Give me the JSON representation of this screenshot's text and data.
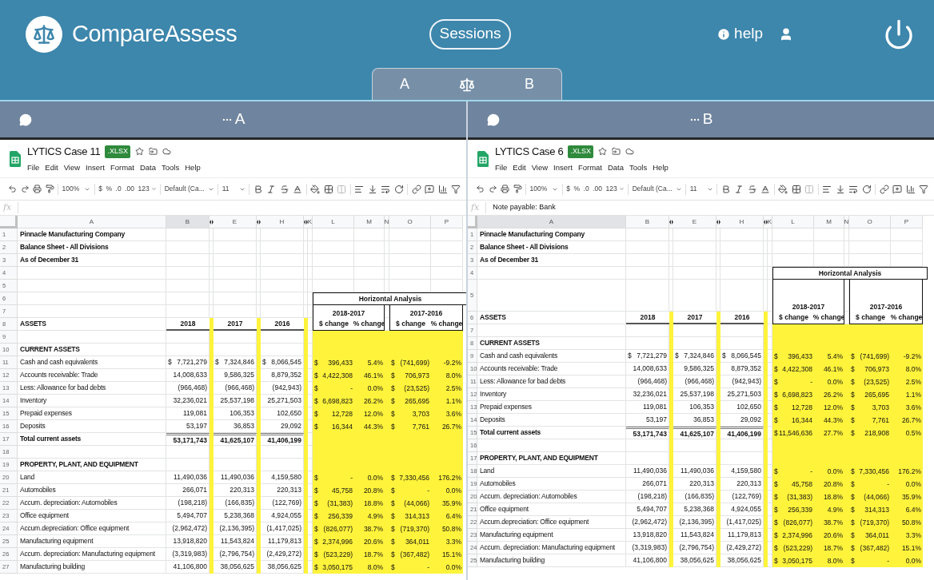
{
  "app": {
    "name": "CompareAssess",
    "sessions": "Sessions",
    "help": "help"
  },
  "compare_tabs": [
    "A",
    "B"
  ],
  "panes": [
    {
      "label": "A",
      "doc": {
        "title": "LYTICS Case 11",
        "badge": ".XLSX",
        "menu": [
          "File",
          "Edit",
          "View",
          "Insert",
          "Format",
          "Data",
          "Tools",
          "Help"
        ]
      },
      "toolbar": {
        "zoom": "100%",
        "currency": "$",
        "percent": "%",
        "dec_less": ".0",
        "dec_more": ".00",
        "format": "123",
        "font": "Default (Ca...",
        "size": "11"
      },
      "formula": {
        "label": "fx"
      },
      "columns": [
        {
          "label": "A",
          "selected": false
        },
        {
          "label": "B",
          "selected": true
        },
        {
          "label": "E",
          "selected": false
        },
        {
          "label": "H",
          "selected": false
        },
        {
          "label": "K",
          "selected": false
        },
        {
          "label": "L",
          "selected": false
        },
        {
          "label": "M",
          "selected": false
        },
        {
          "label": "N",
          "selected": false
        },
        {
          "label": "O",
          "selected": false
        },
        {
          "label": "P",
          "selected": false
        }
      ],
      "rows": [
        {
          "n": "1",
          "kind": "title",
          "a": "Pinnacle Manufacturing Company",
          "highlight": false,
          "tall": false
        },
        {
          "n": "2",
          "kind": "title",
          "a": "Balance Sheet - All Divisions",
          "highlight": false,
          "tall": false
        },
        {
          "n": "3",
          "kind": "title",
          "a": "As of December 31",
          "highlight": false,
          "tall": false
        },
        {
          "n": "4",
          "kind": "blank",
          "highlight": false,
          "tall": false
        },
        {
          "n": "5",
          "kind": "blank",
          "highlight": false,
          "tall": false
        },
        {
          "n": "6",
          "kind": "ha_title",
          "label": "Horizontal Analysis",
          "highlight": false,
          "tall": false
        },
        {
          "n": "7",
          "kind": "ha_period",
          "periods": [
            "2018-2017",
            "2017-2016"
          ],
          "highlight": false,
          "tall": false
        },
        {
          "n": "8",
          "kind": "header",
          "a": "ASSETS",
          "v": [
            "2018",
            "2017",
            "2016",
            "$ change",
            "% change",
            "$ change",
            "% change"
          ],
          "highlight": false,
          "tall": false
        },
        {
          "n": "9",
          "kind": "blank",
          "highlight": true,
          "tall": false
        },
        {
          "n": "10",
          "kind": "section",
          "a": "CURRENT ASSETS",
          "highlight": true,
          "tall": false
        },
        {
          "n": "11",
          "kind": "data",
          "a": "Cash and cash equivalents",
          "cells": [
            {
              "sign": "$",
              "v": "7,721,279"
            },
            {
              "sign": "$",
              "v": "7,324,846"
            },
            {
              "sign": "$",
              "v": "8,066,545"
            },
            {
              "sign": "$",
              "v": "396,433"
            },
            {
              "v": "5.4%"
            },
            {
              "sign": "$",
              "v": "(741,699)"
            },
            {
              "v": "-9.2%"
            }
          ],
          "highlight": true,
          "tall": false
        },
        {
          "n": "12",
          "kind": "data",
          "a": "Accounts receivable: Trade",
          "cells": [
            {
              "v": "14,008,633"
            },
            {
              "v": "9,586,325"
            },
            {
              "v": "8,879,352"
            },
            {
              "sign": "$",
              "v": "4,422,308"
            },
            {
              "v": "46.1%"
            },
            {
              "sign": "$",
              "v": "706,973"
            },
            {
              "v": "8.0%"
            }
          ],
          "highlight": true,
          "tall": false
        },
        {
          "n": "13",
          "kind": "data",
          "a": "Less: Allowance for bad debts",
          "cells": [
            {
              "v": "(966,468)"
            },
            {
              "v": "(966,468)"
            },
            {
              "v": "(942,943)"
            },
            {
              "sign": "$",
              "v": "-"
            },
            {
              "v": "0.0%"
            },
            {
              "sign": "$",
              "v": "(23,525)"
            },
            {
              "v": "2.5%"
            }
          ],
          "highlight": true,
          "tall": false
        },
        {
          "n": "14",
          "kind": "data",
          "a": "Inventory",
          "cells": [
            {
              "v": "32,236,021"
            },
            {
              "v": "25,537,198"
            },
            {
              "v": "25,271,503"
            },
            {
              "sign": "$",
              "v": "6,698,823"
            },
            {
              "v": "26.2%"
            },
            {
              "sign": "$",
              "v": "265,695"
            },
            {
              "v": "1.1%"
            }
          ],
          "highlight": true,
          "tall": false
        },
        {
          "n": "15",
          "kind": "data",
          "a": "Prepaid expenses",
          "cells": [
            {
              "v": "119,081"
            },
            {
              "v": "106,353"
            },
            {
              "v": "102,650"
            },
            {
              "sign": "$",
              "v": "12,728"
            },
            {
              "v": "12.0%"
            },
            {
              "sign": "$",
              "v": "3,703"
            },
            {
              "v": "3.6%"
            }
          ],
          "highlight": true,
          "tall": false
        },
        {
          "n": "16",
          "kind": "data",
          "a": "Deposits",
          "cells": [
            {
              "v": "53,197"
            },
            {
              "v": "36,853"
            },
            {
              "v": "29,092"
            },
            {
              "sign": "$",
              "v": "16,344"
            },
            {
              "v": "44.3%"
            },
            {
              "sign": "$",
              "v": "7,761"
            },
            {
              "v": "26.7%"
            }
          ],
          "highlight": true,
          "tall": false
        },
        {
          "n": "17",
          "kind": "total",
          "a": "Total current assets",
          "cells": [
            {
              "v": "53,171,743"
            },
            {
              "v": "41,625,107"
            },
            {
              "v": "41,406,199"
            }
          ],
          "highlight": true,
          "tall": false
        },
        {
          "n": "18",
          "kind": "blank",
          "highlight": true,
          "tall": false
        },
        {
          "n": "19",
          "kind": "section",
          "a": "PROPERTY, PLANT, AND EQUIPMENT",
          "highlight": true,
          "tall": false
        },
        {
          "n": "20",
          "kind": "data",
          "a": "Land",
          "cells": [
            {
              "v": "11,490,036"
            },
            {
              "v": "11,490,036"
            },
            {
              "v": "4,159,580"
            },
            {
              "sign": "$",
              "v": "-"
            },
            {
              "v": "0.0%"
            },
            {
              "sign": "$",
              "v": "7,330,456"
            },
            {
              "v": "176.2%"
            }
          ],
          "highlight": true,
          "tall": false
        },
        {
          "n": "21",
          "kind": "data",
          "a": "Automobiles",
          "cells": [
            {
              "v": "266,071"
            },
            {
              "v": "220,313"
            },
            {
              "v": "220,313"
            },
            {
              "sign": "$",
              "v": "45,758"
            },
            {
              "v": "20.8%"
            },
            {
              "sign": "$",
              "v": "-"
            },
            {
              "v": "0.0%"
            }
          ],
          "highlight": true,
          "tall": false
        },
        {
          "n": "22",
          "kind": "data",
          "a": "Accum. depreciation: Automobiles",
          "cells": [
            {
              "v": "(198,218)"
            },
            {
              "v": "(166,835)"
            },
            {
              "v": "(122,769)"
            },
            {
              "sign": "$",
              "v": "(31,383)"
            },
            {
              "v": "18.8%"
            },
            {
              "sign": "$",
              "v": "(44,066)"
            },
            {
              "v": "35.9%"
            }
          ],
          "highlight": true,
          "tall": false
        },
        {
          "n": "23",
          "kind": "data",
          "a": "Office equipment",
          "cells": [
            {
              "v": "5,494,707"
            },
            {
              "v": "5,238,368"
            },
            {
              "v": "4,924,055"
            },
            {
              "sign": "$",
              "v": "256,339"
            },
            {
              "v": "4.9%"
            },
            {
              "sign": "$",
              "v": "314,313"
            },
            {
              "v": "6.4%"
            }
          ],
          "highlight": true,
          "tall": false
        },
        {
          "n": "24",
          "kind": "data",
          "a": "Accum.depreciation: Office equipment",
          "cells": [
            {
              "v": "(2,962,472)"
            },
            {
              "v": "(2,136,395)"
            },
            {
              "v": "(1,417,025)"
            },
            {
              "sign": "$",
              "v": "(826,077)"
            },
            {
              "v": "38.7%"
            },
            {
              "sign": "$",
              "v": "(719,370)"
            },
            {
              "v": "50.8%"
            }
          ],
          "highlight": true,
          "tall": false
        },
        {
          "n": "25",
          "kind": "data",
          "a": "Manufacturing equipment",
          "cells": [
            {
              "v": "13,918,820"
            },
            {
              "v": "11,543,824"
            },
            {
              "v": "11,179,813"
            },
            {
              "sign": "$",
              "v": "2,374,996"
            },
            {
              "v": "20.6%"
            },
            {
              "sign": "$",
              "v": "364,011"
            },
            {
              "v": "3.3%"
            }
          ],
          "highlight": true,
          "tall": false
        },
        {
          "n": "26",
          "kind": "data",
          "a": "Accum. depreciation: Manufacturing equipment",
          "cells": [
            {
              "v": "(3,319,983)"
            },
            {
              "v": "(2,796,754)"
            },
            {
              "v": "(2,429,272)"
            },
            {
              "sign": "$",
              "v": "(523,229)"
            },
            {
              "v": "18.7%"
            },
            {
              "sign": "$",
              "v": "(367,482)"
            },
            {
              "v": "15.1%"
            }
          ],
          "highlight": true,
          "tall": false
        },
        {
          "n": "27",
          "kind": "data",
          "a": "Manufacturing building",
          "cells": [
            {
              "v": "41,106,800"
            },
            {
              "v": "38,056,625"
            },
            {
              "v": "38,056,625"
            },
            {
              "sign": "$",
              "v": "3,050,175"
            },
            {
              "v": "8.0%"
            },
            {
              "sign": "$",
              "v": "-"
            },
            {
              "v": "0.0%"
            }
          ],
          "highlight": true,
          "tall": false
        }
      ]
    },
    {
      "label": "B",
      "doc": {
        "title": "LYTICS Case 6",
        "badge": ".XLSX",
        "menu": [
          "File",
          "Edit",
          "View",
          "Insert",
          "Format",
          "Data",
          "Tools",
          "Help"
        ]
      },
      "toolbar": {
        "zoom": "100%",
        "currency": "$",
        "percent": "%",
        "dec_less": ".0",
        "dec_more": ".00",
        "format": "123",
        "font": "Default (Ca...",
        "size": "11"
      },
      "formula": {
        "label": "fx",
        "value": "Note payable: Bank"
      },
      "columns": [
        {
          "label": "A",
          "selected": true
        },
        {
          "label": "B",
          "selected": false
        },
        {
          "label": "E",
          "selected": false
        },
        {
          "label": "H",
          "selected": false
        },
        {
          "label": "K",
          "selected": false
        },
        {
          "label": "L",
          "selected": false
        },
        {
          "label": "M",
          "selected": false
        },
        {
          "label": "N",
          "selected": false
        },
        {
          "label": "O",
          "selected": false
        },
        {
          "label": "P",
          "selected": false
        }
      ],
      "rows": [
        {
          "n": "1",
          "kind": "title",
          "a": "Pinnacle Manufacturing Company",
          "highlight": false,
          "tall": false
        },
        {
          "n": "2",
          "kind": "title",
          "a": "Balance Sheet - All Divisions",
          "highlight": false,
          "tall": false
        },
        {
          "n": "3",
          "kind": "title",
          "a": "As of December 31",
          "highlight": false,
          "tall": false
        },
        {
          "n": "4",
          "kind": "ha_title",
          "label": "Horizontal Analysis",
          "highlight": false,
          "tall": false
        },
        {
          "n": "5",
          "kind": "ha_period",
          "periods": [
            "2018-2017",
            "2017-2016"
          ],
          "highlight": false,
          "tall": true
        },
        {
          "n": "6",
          "kind": "header",
          "a": "ASSETS",
          "v": [
            "2018",
            "2017",
            "2016",
            "$ change",
            "% change",
            "$ change",
            "% change"
          ],
          "highlight": false,
          "tall": false
        },
        {
          "n": "7",
          "kind": "blank",
          "highlight": true,
          "tall": false
        },
        {
          "n": "8",
          "kind": "section",
          "a": "CURRENT ASSETS",
          "highlight": true,
          "tall": false
        },
        {
          "n": "9",
          "kind": "data",
          "a": "Cash and cash equivalents",
          "cells": [
            {
              "sign": "$",
              "v": "7,721,279"
            },
            {
              "sign": "$",
              "v": "7,324,846"
            },
            {
              "sign": "$",
              "v": "8,066,545"
            },
            {
              "sign": "$",
              "v": "396,433"
            },
            {
              "v": "5.4%"
            },
            {
              "sign": "$",
              "v": "(741,699)"
            },
            {
              "v": "-9.2%"
            }
          ],
          "highlight": true,
          "tall": false
        },
        {
          "n": "10",
          "kind": "data",
          "a": "Accounts receivable: Trade",
          "cells": [
            {
              "v": "14,008,633"
            },
            {
              "v": "9,586,325"
            },
            {
              "v": "8,879,352"
            },
            {
              "sign": "$",
              "v": "4,422,308"
            },
            {
              "v": "46.1%"
            },
            {
              "sign": "$",
              "v": "706,973"
            },
            {
              "v": "8.0%"
            }
          ],
          "highlight": true,
          "tall": false
        },
        {
          "n": "11",
          "kind": "data",
          "a": "Less: Allowance for bad debts",
          "cells": [
            {
              "v": "(966,468)"
            },
            {
              "v": "(966,468)"
            },
            {
              "v": "(942,943)"
            },
            {
              "sign": "$",
              "v": "-"
            },
            {
              "v": "0.0%"
            },
            {
              "sign": "$",
              "v": "(23,525)"
            },
            {
              "v": "2.5%"
            }
          ],
          "highlight": true,
          "tall": false
        },
        {
          "n": "12",
          "kind": "data",
          "a": "Inventory",
          "cells": [
            {
              "v": "32,236,021"
            },
            {
              "v": "25,537,198"
            },
            {
              "v": "25,271,503"
            },
            {
              "sign": "$",
              "v": "6,698,823"
            },
            {
              "v": "26.2%"
            },
            {
              "sign": "$",
              "v": "265,695"
            },
            {
              "v": "1.1%"
            }
          ],
          "highlight": true,
          "tall": false
        },
        {
          "n": "13",
          "kind": "data",
          "a": "Prepaid expenses",
          "cells": [
            {
              "v": "119,081"
            },
            {
              "v": "106,353"
            },
            {
              "v": "102,650"
            },
            {
              "sign": "$",
              "v": "12,728"
            },
            {
              "v": "12.0%"
            },
            {
              "sign": "$",
              "v": "3,703"
            },
            {
              "v": "3.6%"
            }
          ],
          "highlight": true,
          "tall": false
        },
        {
          "n": "14",
          "kind": "data",
          "a": "Deposits",
          "cells": [
            {
              "v": "53,197"
            },
            {
              "v": "36,853"
            },
            {
              "v": "29,092"
            },
            {
              "sign": "$",
              "v": "16,344"
            },
            {
              "v": "44.3%"
            },
            {
              "sign": "$",
              "v": "7,761"
            },
            {
              "v": "26.7%"
            }
          ],
          "highlight": true,
          "tall": false
        },
        {
          "n": "15",
          "kind": "total",
          "a": "Total current assets",
          "cells": [
            {
              "v": "53,171,743"
            },
            {
              "v": "41,625,107"
            },
            {
              "v": "41,406,199"
            },
            {
              "sign": "$",
              "v": "11,546,636"
            },
            {
              "v": "27.7%"
            },
            {
              "sign": "$",
              "v": "218,908"
            },
            {
              "v": "0.5%"
            }
          ],
          "highlight": true,
          "tall": false
        },
        {
          "n": "16",
          "kind": "blank",
          "highlight": true,
          "tall": false
        },
        {
          "n": "17",
          "kind": "section",
          "a": "PROPERTY, PLANT, AND EQUIPMENT",
          "highlight": true,
          "tall": false
        },
        {
          "n": "18",
          "kind": "data",
          "a": "Land",
          "cells": [
            {
              "v": "11,490,036"
            },
            {
              "v": "11,490,036"
            },
            {
              "v": "4,159,580"
            },
            {
              "sign": "$",
              "v": "-"
            },
            {
              "v": "0.0%"
            },
            {
              "sign": "$",
              "v": "7,330,456"
            },
            {
              "v": "176.2%"
            }
          ],
          "highlight": true,
          "tall": false
        },
        {
          "n": "19",
          "kind": "data",
          "a": "Automobiles",
          "cells": [
            {
              "v": "266,071"
            },
            {
              "v": "220,313"
            },
            {
              "v": "220,313"
            },
            {
              "sign": "$",
              "v": "45,758"
            },
            {
              "v": "20.8%"
            },
            {
              "sign": "$",
              "v": "-"
            },
            {
              "v": "0.0%"
            }
          ],
          "highlight": true,
          "tall": false
        },
        {
          "n": "20",
          "kind": "data",
          "a": "Accum. depreciation: Automobiles",
          "cells": [
            {
              "v": "(198,218)"
            },
            {
              "v": "(166,835)"
            },
            {
              "v": "(122,769)"
            },
            {
              "sign": "$",
              "v": "(31,383)"
            },
            {
              "v": "18.8%"
            },
            {
              "sign": "$",
              "v": "(44,066)"
            },
            {
              "v": "35.9%"
            }
          ],
          "highlight": true,
          "tall": false
        },
        {
          "n": "21",
          "kind": "data",
          "a": "Office equipment",
          "cells": [
            {
              "v": "5,494,707"
            },
            {
              "v": "5,238,368"
            },
            {
              "v": "4,924,055"
            },
            {
              "sign": "$",
              "v": "256,339"
            },
            {
              "v": "4.9%"
            },
            {
              "sign": "$",
              "v": "314,313"
            },
            {
              "v": "6.4%"
            }
          ],
          "highlight": true,
          "tall": false
        },
        {
          "n": "22",
          "kind": "data",
          "a": "Accum.depreciation: Office equipment",
          "cells": [
            {
              "v": "(2,962,472)"
            },
            {
              "v": "(2,136,395)"
            },
            {
              "v": "(1,417,025)"
            },
            {
              "sign": "$",
              "v": "(826,077)"
            },
            {
              "v": "38.7%"
            },
            {
              "sign": "$",
              "v": "(719,370)"
            },
            {
              "v": "50.8%"
            }
          ],
          "highlight": true,
          "tall": false
        },
        {
          "n": "23",
          "kind": "data",
          "a": "Manufacturing equipment",
          "cells": [
            {
              "v": "13,918,820"
            },
            {
              "v": "11,543,824"
            },
            {
              "v": "11,179,813"
            },
            {
              "sign": "$",
              "v": "2,374,996"
            },
            {
              "v": "20.6%"
            },
            {
              "sign": "$",
              "v": "364,011"
            },
            {
              "v": "3.3%"
            }
          ],
          "highlight": true,
          "tall": false
        },
        {
          "n": "24",
          "kind": "data",
          "a": "Accum. depreciation: Manufacturing equipment",
          "cells": [
            {
              "v": "(3,319,983)"
            },
            {
              "v": "(2,796,754)"
            },
            {
              "v": "(2,429,272)"
            },
            {
              "sign": "$",
              "v": "(523,229)"
            },
            {
              "v": "18.7%"
            },
            {
              "sign": "$",
              "v": "(367,482)"
            },
            {
              "v": "15.1%"
            }
          ],
          "highlight": true,
          "tall": false
        },
        {
          "n": "25",
          "kind": "data",
          "a": "Manufacturing building",
          "cells": [
            {
              "v": "41,106,800"
            },
            {
              "v": "38,056,625"
            },
            {
              "v": "38,056,625"
            },
            {
              "sign": "$",
              "v": "3,050,175"
            },
            {
              "v": "8.0%"
            },
            {
              "sign": "$",
              "v": "-"
            },
            {
              "v": "0.0%"
            }
          ],
          "highlight": true,
          "tall": false
        }
      ]
    }
  ]
}
